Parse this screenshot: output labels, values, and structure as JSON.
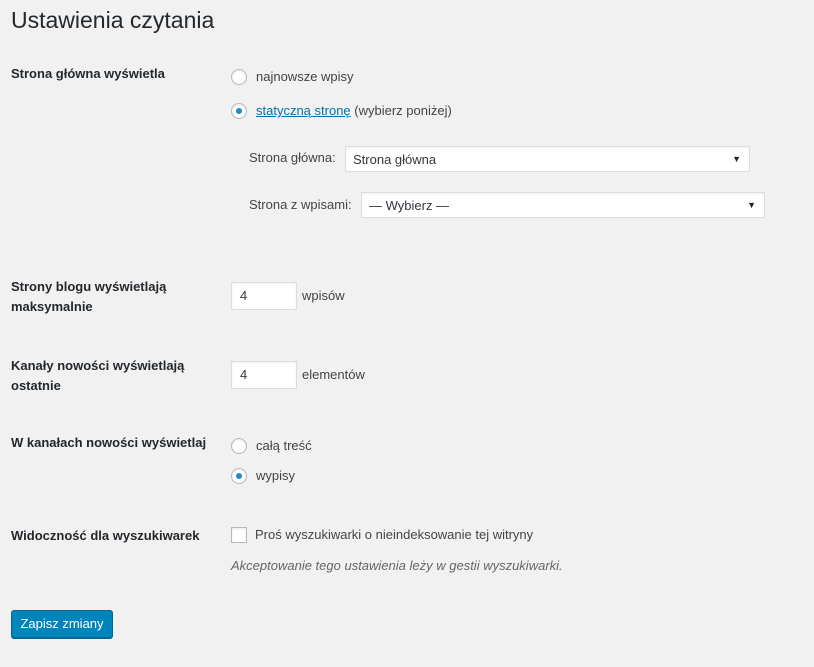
{
  "page": {
    "title": "Ustawienia czytania"
  },
  "front_page": {
    "label": "Strona główna wyświetla",
    "option_latest": "najnowsze wpisy",
    "option_static_link": "statyczną stronę",
    "option_static_suffix": " (wybierz poniżej)",
    "selected": "static",
    "homepage_label": "Strona główna:",
    "homepage_value": "Strona główna",
    "posts_page_label": "Strona z wpisami:",
    "posts_page_value": "— Wybierz —"
  },
  "posts_per_page": {
    "label": "Strony blogu wyświetlają maksymalnie",
    "value": "4",
    "unit": "wpisów"
  },
  "feed_items": {
    "label": "Kanały nowości wyświetlają ostatnie",
    "value": "4",
    "unit": "elementów"
  },
  "feed_content": {
    "label": "W kanałach nowości wyświetlaj",
    "option_full": "całą treść",
    "option_summary": "wypisy",
    "selected": "summary"
  },
  "search_visibility": {
    "label": "Widoczność dla wyszukiwarek",
    "checkbox_label": "Proś wyszukiwarki o nieindeksowanie tej witryny",
    "checked": false,
    "description": "Akceptowanie tego ustawienia leży w gestii wyszukiwarki."
  },
  "actions": {
    "save_label": "Zapisz zmiany"
  },
  "colors": {
    "accent": "#0085ba",
    "link": "#0073aa",
    "background": "#f1f1f1"
  }
}
